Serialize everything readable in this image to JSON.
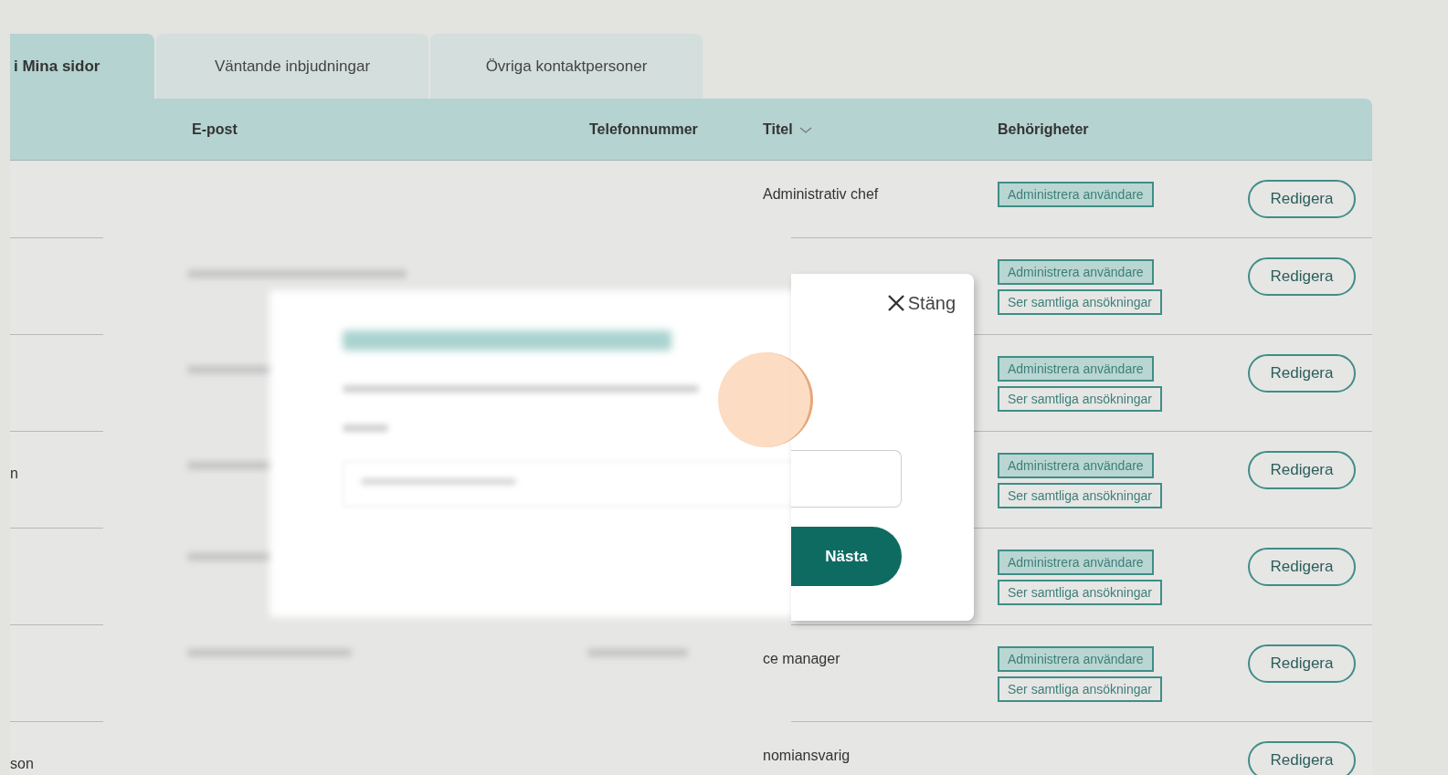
{
  "tabs": [
    {
      "label": "i Mina sidor",
      "selected": true
    },
    {
      "label": "Väntande inbjudningar",
      "selected": false
    },
    {
      "label": "Övriga kontaktpersoner",
      "selected": false
    }
  ],
  "table": {
    "columns": [
      {
        "label": "E-post",
        "sortable": false
      },
      {
        "label": "Telefonnummer",
        "sortable": false
      },
      {
        "label": "Titel",
        "sortable": true
      },
      {
        "label": "Behörigheter",
        "sortable": false
      }
    ],
    "rows": [
      {
        "name": "",
        "title": "Administrativ chef",
        "permissions": [
          {
            "label": "Administrera användare",
            "kind": "filled"
          }
        ],
        "action": "Redigera"
      },
      {
        "name": "",
        "title": "",
        "permissions": [
          {
            "label": "Administrera användare",
            "kind": "filled"
          },
          {
            "label": "Ser samtliga ansökningar",
            "kind": "outlined"
          }
        ],
        "action": "Redigera"
      },
      {
        "name": "",
        "title": "",
        "permissions": [
          {
            "label": "Administrera användare",
            "kind": "filled"
          },
          {
            "label": "Ser samtliga ansökningar",
            "kind": "outlined"
          }
        ],
        "action": "Redigera"
      },
      {
        "name": "n",
        "title": "",
        "permissions": [
          {
            "label": "Administrera användare",
            "kind": "filled"
          },
          {
            "label": "Ser samtliga ansökningar",
            "kind": "outlined"
          }
        ],
        "action": "Redigera"
      },
      {
        "name": "",
        "title": "",
        "permissions": [
          {
            "label": "Administrera användare",
            "kind": "filled"
          },
          {
            "label": "Ser samtliga ansökningar",
            "kind": "outlined"
          }
        ],
        "action": "Redigera"
      },
      {
        "name": "",
        "title": "ce manager",
        "permissions": [
          {
            "label": "Administrera användare",
            "kind": "filled"
          },
          {
            "label": "Ser samtliga ansökningar",
            "kind": "outlined"
          }
        ],
        "action": "Redigera"
      },
      {
        "name": "son",
        "title": "nomiansvarig",
        "permissions": [],
        "action": "Redigera"
      }
    ]
  },
  "dialog": {
    "close": "Stäng",
    "next": "Nästa"
  }
}
